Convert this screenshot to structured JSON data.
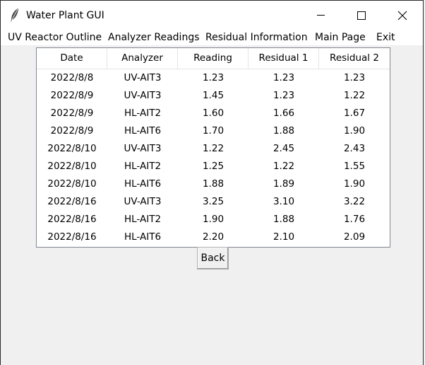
{
  "window": {
    "title": "Water Plant GUI"
  },
  "menu": {
    "items": [
      "UV Reactor Outline",
      "Analyzer Readings",
      "Residual Information",
      "Main Page",
      "Exit"
    ]
  },
  "table": {
    "columns": [
      "Date",
      "Analyzer",
      "Reading",
      "Residual 1",
      "Residual 2"
    ],
    "rows": [
      [
        "2022/8/8",
        "UV-AIT3",
        "1.23",
        "1.23",
        "1.23"
      ],
      [
        "2022/8/9",
        "UV-AIT3",
        "1.45",
        "1.23",
        "1.22"
      ],
      [
        "2022/8/9",
        "HL-AIT2",
        "1.60",
        "1.66",
        "1.67"
      ],
      [
        "2022/8/9",
        "HL-AIT6",
        "1.70",
        "1.88",
        "1.90"
      ],
      [
        "2022/8/10",
        "UV-AIT3",
        "1.22",
        "2.45",
        "2.43"
      ],
      [
        "2022/8/10",
        "HL-AIT2",
        "1.25",
        "1.22",
        "1.55"
      ],
      [
        "2022/8/10",
        "HL-AIT6",
        "1.88",
        "1.89",
        "1.90"
      ],
      [
        "2022/8/16",
        "UV-AIT3",
        "3.25",
        "3.10",
        "3.22"
      ],
      [
        "2022/8/16",
        "HL-AIT2",
        "1.90",
        "1.88",
        "1.76"
      ],
      [
        "2022/8/16",
        "HL-AIT6",
        "2.20",
        "2.10",
        "2.09"
      ]
    ]
  },
  "buttons": {
    "back_label": "Back"
  },
  "icons": {
    "app": "feather-icon",
    "minimize": "minimize-icon",
    "maximize": "maximize-icon",
    "close": "close-icon"
  }
}
